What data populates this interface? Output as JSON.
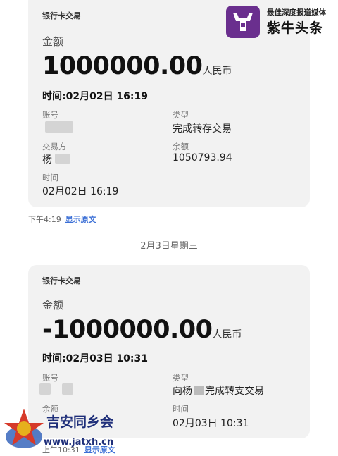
{
  "card1": {
    "title": "银行卡交易",
    "amount_label": "金额",
    "amount": "1000000.00",
    "unit": "人民币",
    "time": "时间:02月02日 16:19",
    "account_label": "账号",
    "type_label": "类型",
    "type_value": "完成转存交易",
    "counterparty_label": "交易方",
    "counterparty_value": "杨",
    "balance_label": "余额",
    "balance_value": "1050793.94",
    "time_label": "时间",
    "time_value": "02月02日 16:19"
  },
  "card1_meta": {
    "time": "下午4:19",
    "link": "显示原文"
  },
  "date_separator": "2月3日星期三",
  "card2": {
    "title": "银行卡交易",
    "amount_label": "金额",
    "amount": "-1000000.00",
    "unit": "人民币",
    "time": "时间:02月03日 10:31",
    "account_label": "账号",
    "type_label": "类型",
    "type_value_prefix": "向杨",
    "type_value_suffix": "完成转支交易",
    "balance_label": "余额",
    "time_label": "时间",
    "time_value": "02月03日 10:31"
  },
  "card2_meta": {
    "time": "上午10:31",
    "link": "显示原文"
  },
  "watermark_top": {
    "tagline": "最佳深度报道媒体",
    "name": "紫牛头条",
    "color": "#6a2f8e"
  },
  "watermark_bottom": {
    "name": "吉安同乡会",
    "url": "www.jatxh.cn",
    "color": "#1f2f7a"
  }
}
